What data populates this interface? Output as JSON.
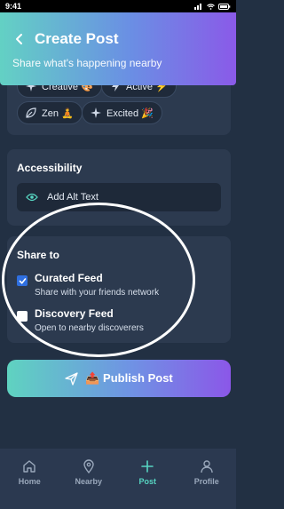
{
  "status_bar": {
    "time": "9:41"
  },
  "header": {
    "title": "Create Post",
    "subtitle": "Share what's happening nearby"
  },
  "mood": {
    "chips": [
      {
        "label": "Creative 🎨",
        "icon": "sparkle-icon"
      },
      {
        "label": "Active ⚡",
        "icon": "bolt-icon"
      },
      {
        "label": "Zen 🧘",
        "icon": "leaf-icon"
      },
      {
        "label": "Excited 🎉",
        "icon": "sparkle-icon"
      }
    ]
  },
  "accessibility": {
    "title": "Accessibility",
    "alt_text_label": "Add Alt Text",
    "icon": "eye-icon"
  },
  "share": {
    "title": "Share to",
    "options": [
      {
        "title": "Curated Feed",
        "description": "Share with your friends network",
        "checked": true
      },
      {
        "title": "Discovery Feed",
        "description": "Open to nearby discoverers",
        "checked": false
      }
    ]
  },
  "publish_button": {
    "label": "📤 Publish Post"
  },
  "nav": {
    "items": [
      {
        "label": "Home",
        "icon": "home-icon"
      },
      {
        "label": "Nearby",
        "icon": "map-pin-icon"
      },
      {
        "label": "Post",
        "icon": "plus-icon",
        "active": true
      },
      {
        "label": "Profile",
        "icon": "user-icon"
      }
    ]
  },
  "colors": {
    "accent": "#57d6c2",
    "gradient_start": "#63d1c4",
    "gradient_end": "#8a5ae8",
    "checkbox": "#2f6fe0"
  }
}
